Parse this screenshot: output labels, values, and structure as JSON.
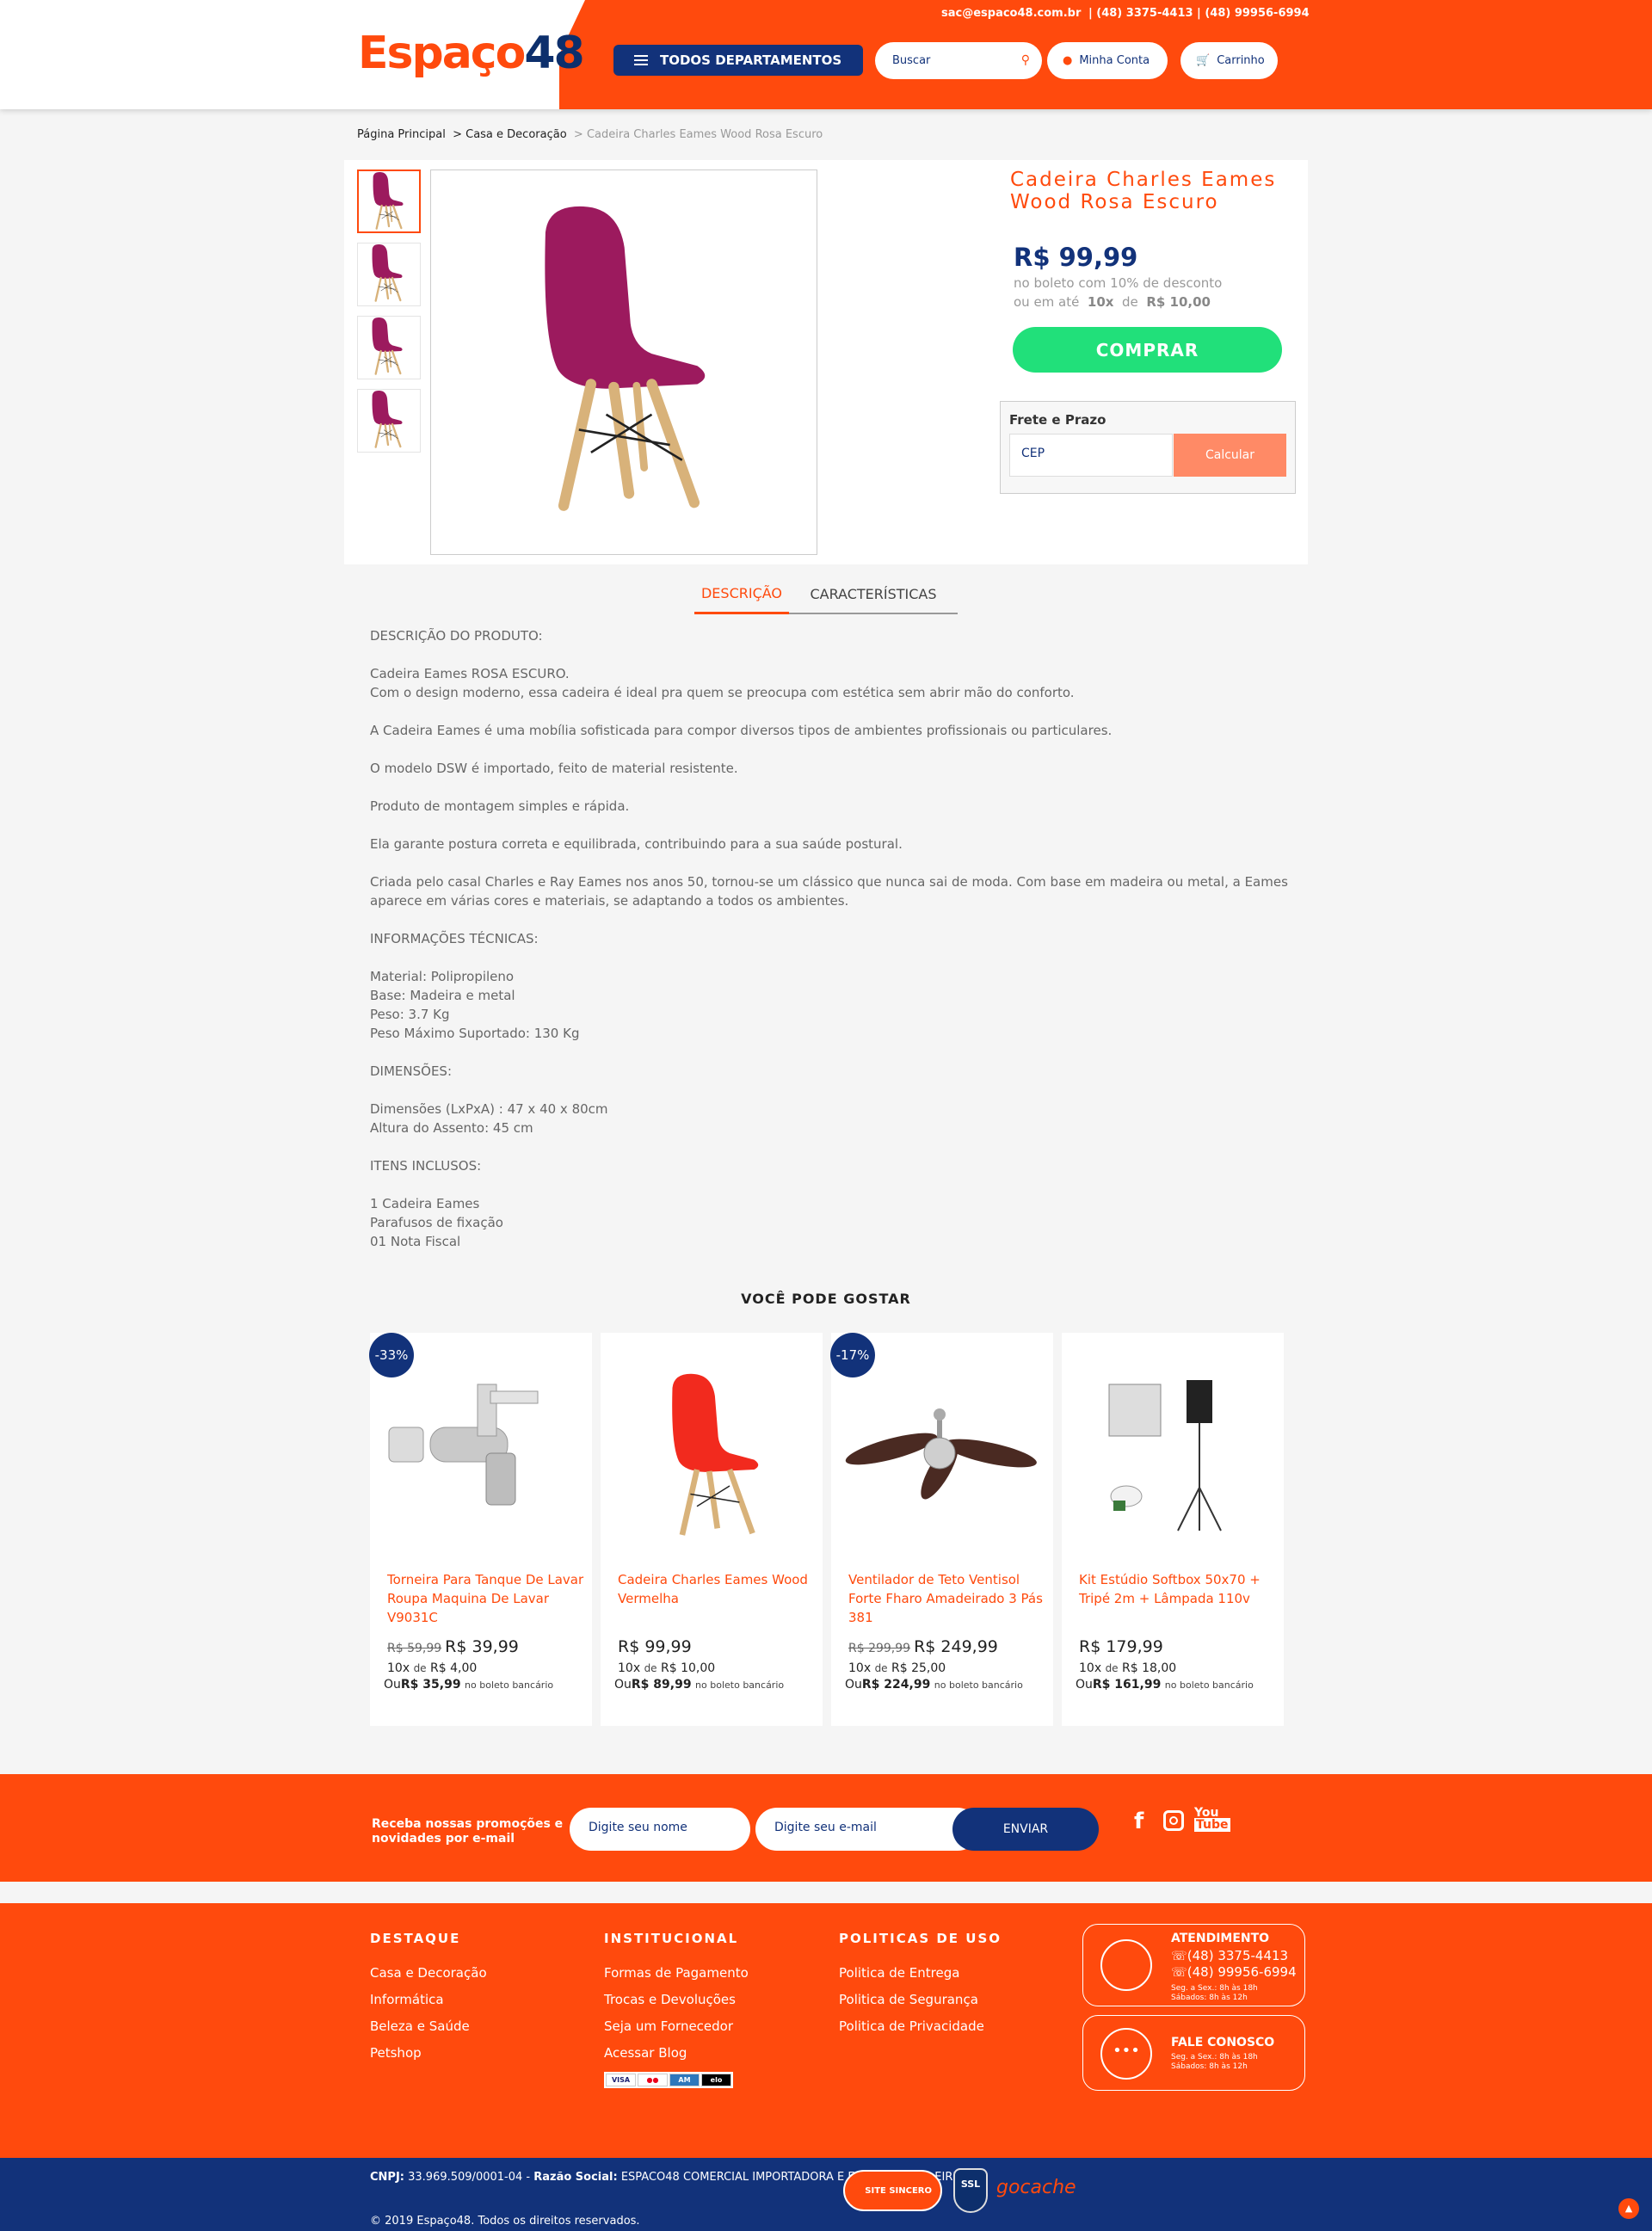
{
  "header": {
    "logo_part1": "Espaço",
    "logo_part2": "48",
    "email": "sac@espaco48.com.br",
    "phones": "| (48) 3375-4413 | (48) 99956-6994",
    "departments_label": "TODOS DEPARTAMENTOS",
    "search_placeholder": "Buscar",
    "account_label": "Minha Conta",
    "cart_label": "Carrinho"
  },
  "breadcrumb": {
    "home": "Página Principal",
    "category": "> Casa e Decoração",
    "current": "> Cadeira Charles Eames Wood Rosa Escuro"
  },
  "product": {
    "title": "Cadeira Charles Eames Wood Rosa Escuro",
    "price": "R$ 99,99",
    "boleto_text": "no boleto com 10% de desconto",
    "installment_prefix": "ou em até",
    "installment_count": "10x",
    "installment_of": "de",
    "installment_value": "R$ 10,00",
    "buy_label": "COMPRAR",
    "shipping_label": "Frete e Prazo",
    "cep_placeholder": "CEP",
    "calc_label": "Calcular",
    "chair_color": "#9c1a5e"
  },
  "tabs": [
    "DESCRIÇÃO",
    "CARACTERÍSTICAS"
  ],
  "description": [
    "DESCRIÇÃO DO PRODUTO:",
    "",
    "Cadeira Eames ROSA ESCURO.",
    "Com o design moderno, essa cadeira é ideal pra quem se preocupa com estética sem abrir mão do conforto.",
    "",
    "A Cadeira Eames é uma mobília sofisticada para compor diversos tipos de ambientes profissionais ou particulares.",
    "",
    "O modelo DSW é importado, feito de material resistente.",
    "",
    "Produto de montagem simples e rápida.",
    "",
    "Ela garante postura correta e equilibrada, contribuindo para a sua saúde postural.",
    "",
    "Criada pelo casal Charles e Ray Eames nos anos 50, tornou-se um clássico que nunca sai de moda. Com base em madeira ou metal, a Eames aparece em várias cores e materiais, se adaptando a todos os ambientes.",
    "",
    "INFORMAÇÕES TÉCNICAS:",
    "",
    "Material: Polipropileno",
    "Base: Madeira e metal",
    "Peso: 3.7 Kg",
    "Peso Máximo Suportado: 130 Kg",
    "",
    "DIMENSÕES:",
    "",
    "Dimensões (LxPxA) : 47 x 40 x 80cm",
    "Altura do Assento: 45 cm",
    "",
    "ITENS INCLUSOS:",
    "",
    "1 Cadeira Eames",
    "Parafusos de fixação",
    "01 Nota Fiscal"
  ],
  "recommendations": {
    "title": "VOCÊ PODE GOSTAR",
    "items": [
      {
        "badge": "-33%",
        "name": "Torneira Para Tanque De Lavar Roupa Maquina De Lavar V9031C",
        "old_price": "R$ 59,99",
        "price": "R$ 39,99",
        "inst_count": "10x",
        "inst_de": "de",
        "inst_value": "R$ 4,00",
        "bol_prefix": "Ou",
        "bol_value": "R$ 35,99",
        "bol_suffix": "no boleto bancário"
      },
      {
        "badge": "",
        "name": "Cadeira Charles Eames Wood Vermelha",
        "old_price": "",
        "price": "R$ 99,99",
        "inst_count": "10x",
        "inst_de": "de",
        "inst_value": "R$ 10,00",
        "bol_prefix": "Ou",
        "bol_value": "R$ 89,99",
        "bol_suffix": "no boleto bancário"
      },
      {
        "badge": "-17%",
        "name": "Ventilador de Teto Ventisol Forte Fharo Amadeirado 3 Pás 381",
        "old_price": "R$ 299,99",
        "price": "R$ 249,99",
        "inst_count": "10x",
        "inst_de": "de",
        "inst_value": "R$ 25,00",
        "bol_prefix": "Ou",
        "bol_value": "R$ 224,99",
        "bol_suffix": "no boleto bancário"
      },
      {
        "badge": "",
        "name": "Kit Estúdio Softbox 50x70 + Tripé 2m + Lâmpada 110v",
        "old_price": "",
        "price": "R$ 179,99",
        "inst_count": "10x",
        "inst_de": "de",
        "inst_value": "R$ 18,00",
        "bol_prefix": "Ou",
        "bol_value": "R$ 161,99",
        "bol_suffix": "no boleto bancário"
      }
    ]
  },
  "newsletter": {
    "text": "Receba nossas promoções e novidades por e-mail",
    "name_placeholder": "Digite seu nome",
    "email_placeholder": "Digite seu e-mail",
    "button": "ENVIAR"
  },
  "footer": {
    "col1": {
      "title": "DESTAQUE",
      "links": [
        "Casa e Decoração",
        "Informática",
        "Beleza e Saúde",
        "Petshop"
      ]
    },
    "col2": {
      "title": "INSTITUCIONAL",
      "links": [
        "Formas de Pagamento",
        "Trocas e Devoluções",
        "Seja um Fornecedor",
        "Acessar Blog"
      ]
    },
    "col3": {
      "title": "POLITICAS DE USO",
      "links": [
        "Politica de Entrega",
        "Politica de Segurança",
        "Politica de Privacidade"
      ]
    },
    "attend": {
      "title": "ATENDIMENTO",
      "phone1": "(48) 3375-4413",
      "phone2": "(48) 99956-6994",
      "hours1": "Seg. a Sex.: 8h às 18h",
      "hours2": "Sábados: 8h às 12h"
    },
    "contact": {
      "title": "FALE CONOSCO",
      "hours1": "Seg. a Sex.: 8h às 18h",
      "hours2": "Sábados: 8h às 12h"
    },
    "cnpj_label": "CNPJ:",
    "cnpj": "33.969.509/0001-04 -",
    "razao_label": "Razão Social:",
    "razao": "ESPACO48 COMERCIAL IMPORTADORA E EXPORTADORA EIRELI",
    "copyright": "© 2019 Espaço48. Todos os direitos reservados.",
    "seal_site": "SITE SINCERO",
    "seal_ssl": "SSL",
    "seal_gocache": "gocache"
  },
  "colors": {
    "brand_orange": "#ff4a0d",
    "brand_navy": "#12327a",
    "buy_green": "#21e07a"
  }
}
